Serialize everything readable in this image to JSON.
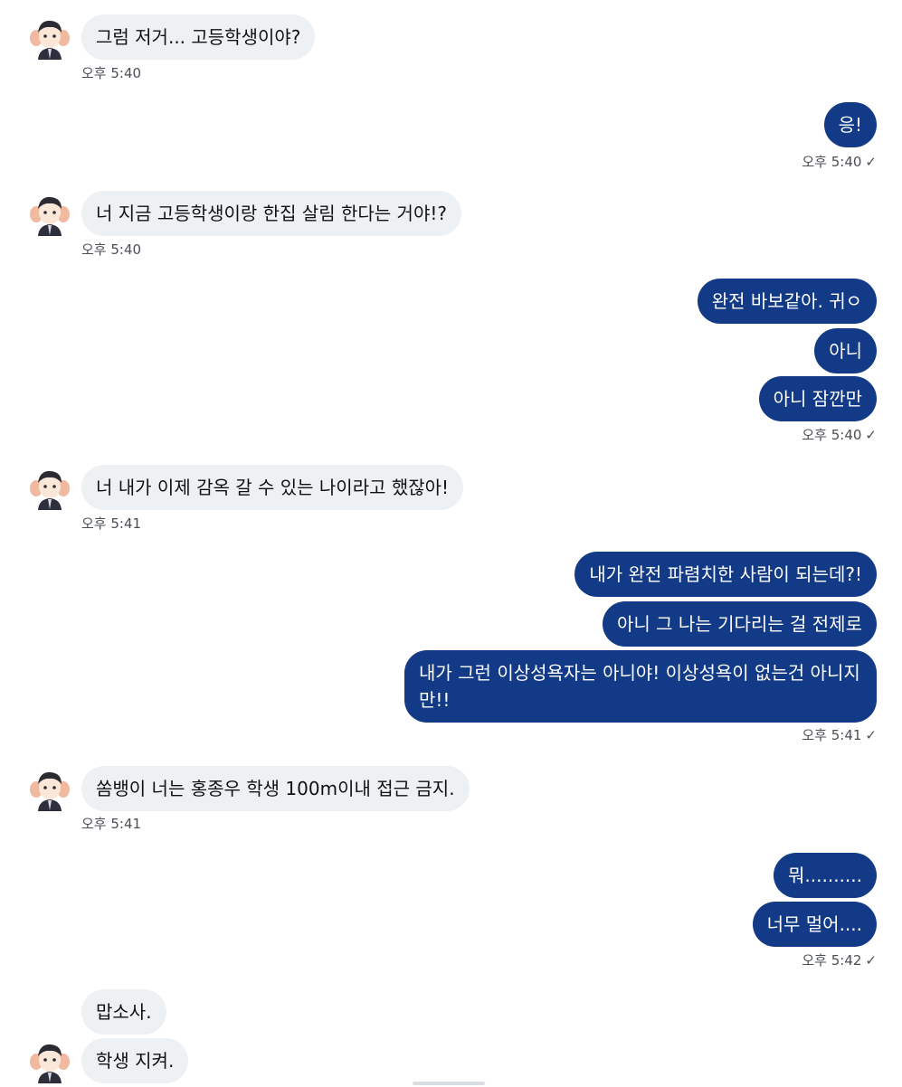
{
  "colors": {
    "incoming_bubble": "#eef1f3",
    "outgoing_bubble": "#123a87",
    "timestamp": "#4b4f55"
  },
  "avatar": {
    "icon": "cartoon-avatar-icon"
  },
  "messages": [
    {
      "text": "그럼 저거... 고등학생이야?"
    },
    {
      "text": "오후 5:40"
    },
    {
      "text": "응!"
    },
    {
      "text": "오후 5:40"
    },
    {
      "text": "너 지금 고등학생이랑 한집 살림 한다는 거야!?"
    },
    {
      "text": "오후 5:40"
    },
    {
      "text": "완전 바보같아. 귀ㅇ"
    },
    {
      "text": "아니"
    },
    {
      "text": "아니 잠깐만"
    },
    {
      "text": "오후 5:40"
    },
    {
      "text": "너 내가 이제 감옥 갈 수 있는 나이라고 했잖아!"
    },
    {
      "text": "오후 5:41"
    },
    {
      "text": "내가 완전 파렴치한 사람이 되는데?!"
    },
    {
      "text": "아니 그 나는 기다리는 걸 전제로"
    },
    {
      "text": "내가 그런 이상성욕자는 아니야! 이상성욕이 없는건 아니지만!!"
    },
    {
      "text": "오후 5:41"
    },
    {
      "text": "쏨뱅이 너는 홍종우 학생 100m이내 접근 금지."
    },
    {
      "text": "오후 5:41"
    },
    {
      "text": "뭐.........."
    },
    {
      "text": "너무 멀어...."
    },
    {
      "text": "오후 5:42"
    },
    {
      "text": "맙소사."
    },
    {
      "text": "학생 지켜."
    }
  ],
  "read_check": "✓"
}
